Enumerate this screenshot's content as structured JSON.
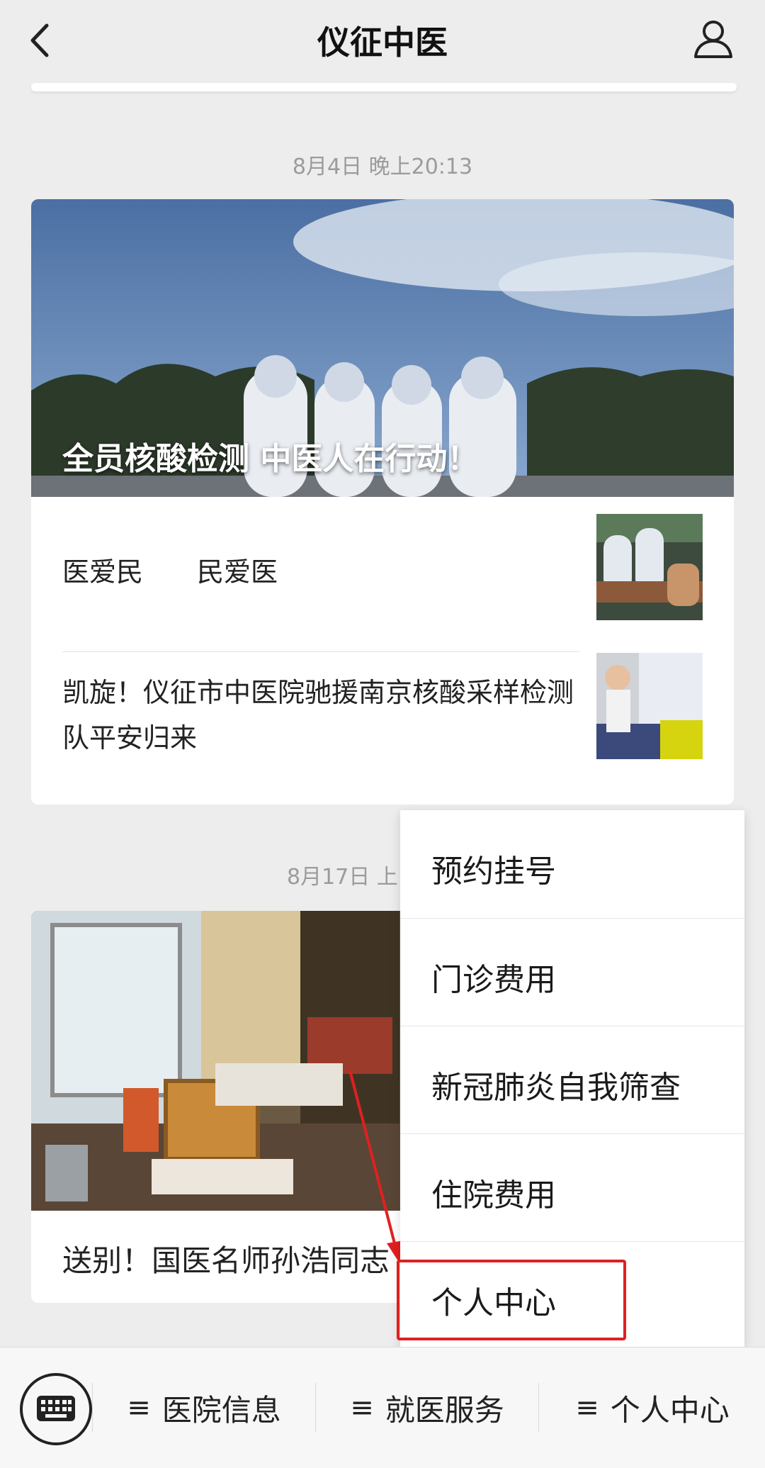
{
  "header": {
    "title": "仪征中医",
    "back_icon": "chevron-left-icon",
    "user_icon": "user-icon"
  },
  "feed": [
    {
      "timestamp": "8月4日 晚上20:13",
      "cover_title": "全员核酸检测 中医人在行动！",
      "items": [
        {
          "title": "医爱民　　民爱医"
        },
        {
          "title": "凯旋！仪征市中医院驰援南京核酸采样检测队平安归来"
        }
      ]
    },
    {
      "timestamp": "8月17日 上",
      "article_title": "送别！国医名师孙浩同志"
    }
  ],
  "menu": {
    "items": [
      {
        "label": "预约挂号"
      },
      {
        "label": "门诊费用"
      },
      {
        "label": "新冠肺炎自我筛查"
      },
      {
        "label": "住院费用"
      },
      {
        "label": "个人中心"
      }
    ],
    "highlighted_index": 4,
    "highlight_color": "#e02020"
  },
  "bottom_bar": {
    "keyboard_icon": "keyboard-icon",
    "tabs": [
      {
        "icon": "≡",
        "label": "医院信息"
      },
      {
        "icon": "≡",
        "label": "就医服务"
      },
      {
        "icon": "≡",
        "label": "个人中心"
      }
    ]
  }
}
